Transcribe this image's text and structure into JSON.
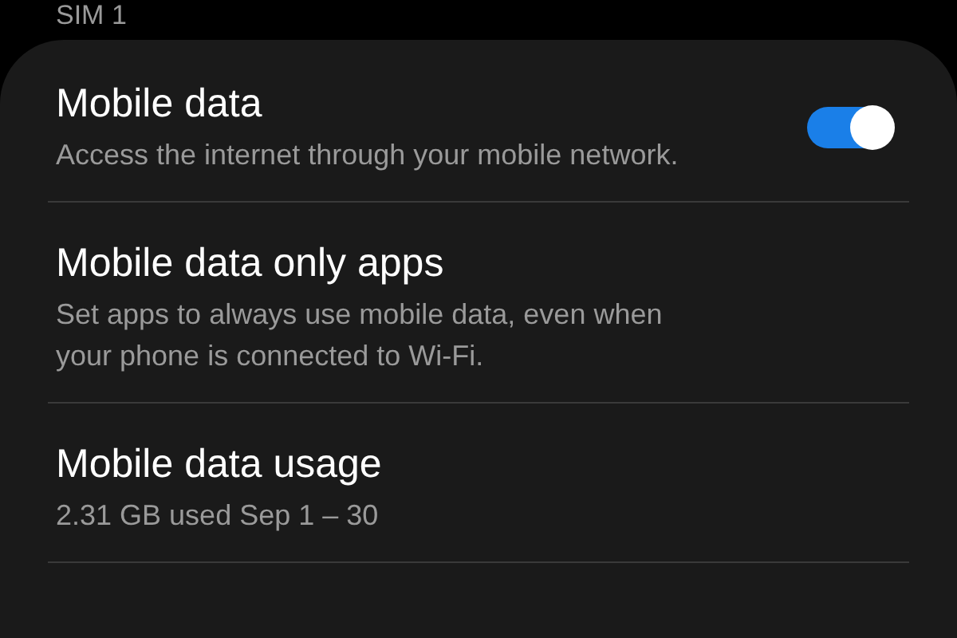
{
  "section_header": "SIM 1",
  "settings": [
    {
      "kind": "toggle",
      "title": "Mobile data",
      "subtitle": "Access the internet through your mobile network.",
      "on": true
    },
    {
      "kind": "plain",
      "title": "Mobile data only apps",
      "subtitle": "Set apps to always use mobile data, even when your phone is connected to Wi-Fi."
    },
    {
      "kind": "plain",
      "title": "Mobile data usage",
      "subtitle": "2.31 GB used Sep 1 – 30"
    }
  ]
}
